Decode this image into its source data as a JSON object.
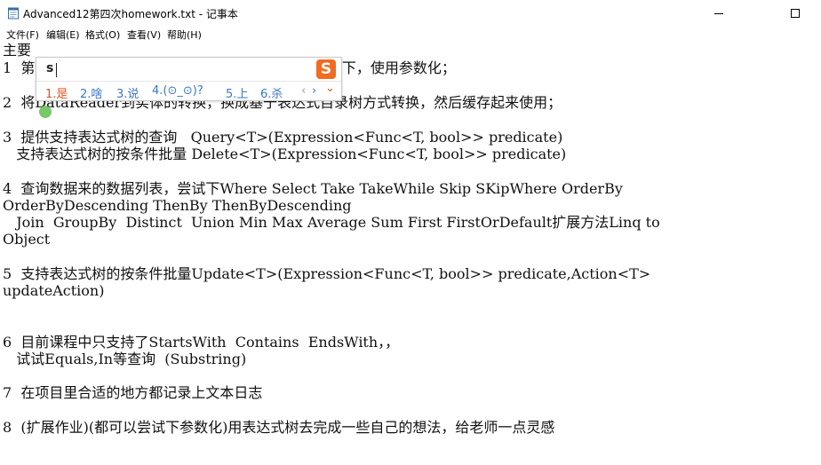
{
  "window": {
    "title": "Advanced12第四次homework.txt - 记事本"
  },
  "menu": [
    "文件(F)",
    "编辑(E)",
    "格式(O)",
    "查看(V)",
    "帮助(H)"
  ],
  "icons": {
    "app": "notepad-icon",
    "minimize": "minimize-icon",
    "maximize": "maximize-icon",
    "close": "close-icon"
  },
  "text_lines": [
    "主要",
    "1  第                                   生成的sql用泛型缓存一下，使用参数化；",
    "2  将DataReader到实体的转换，换成基于表达式目录树方式转换，然后缓存起来使用；",
    "3  提供支持表达式树的查询   Query<T>(Expression<Func<T, bool>> predicate)",
    "   支持表达式树的按条件批量 Delete<T>(Expression<Func<T, bool>> predicate)",
    "4  查询数据来的数据列表，尝试下Where Select Take TakeWhile Skip SKipWhere OrderBy",
    "OrderByDescending ThenBy ThenByDescending",
    "   Join  GroupBy  Distinct  Union Min Max Average Sum First FirstOrDefault扩展方法Linq to",
    "Object",
    "5  支持表达式树的按条件批量Update<T>(Expression<Func<T, bool>> predicate,Action<T>",
    "updateAction)",
    "6  目前课程中只支持了StartsWith  Contains  EndsWith，，",
    "   试试Equals,In等查询  (Substring)",
    "7  在项目里合适的地方都记录上文本日志",
    "8  (扩展作业)(都可以尝试下参数化)用表达式树去完成一些自己的想法，给老师一点灵感"
  ],
  "ime": {
    "input": "s",
    "logo": "S",
    "candidates": [
      "1.是",
      "2.啥",
      "3.说",
      "4.(⊙_⊙)?",
      "5.上",
      "6.杀"
    ],
    "nav_prev": "‹",
    "nav_next": "›",
    "expand": "⌄"
  }
}
